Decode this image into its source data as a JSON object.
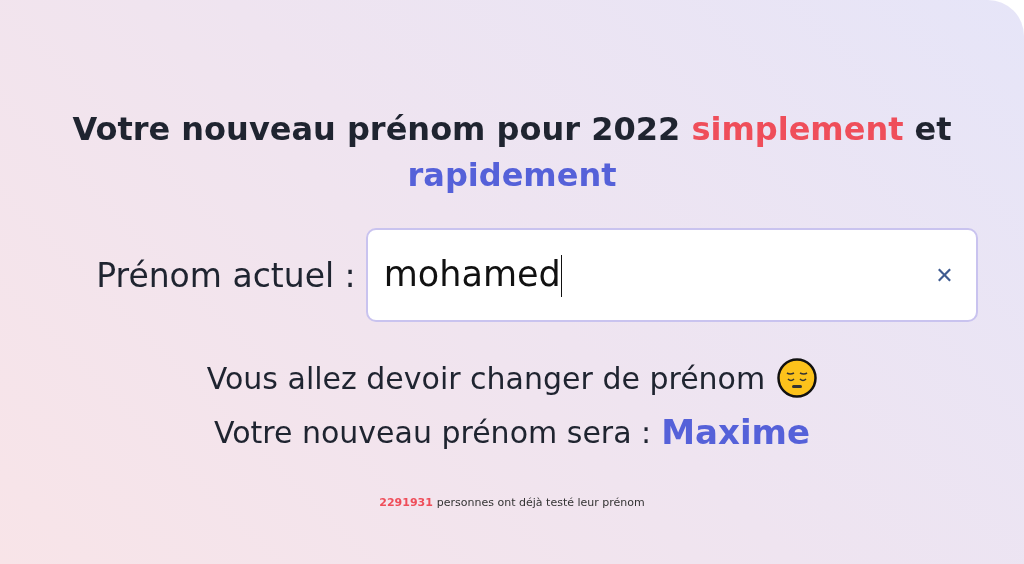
{
  "title": [
    {
      "text": "Votre nouveau prénom pour 2022 ",
      "kind": "plain"
    },
    {
      "text": "simplement",
      "kind": "red"
    },
    {
      "text": " et ",
      "kind": "plain"
    },
    {
      "text": "rapidement",
      "kind": "blue"
    }
  ],
  "field": {
    "label": "Prénom actuel :",
    "value": "mohamed",
    "clear": "✕"
  },
  "verdict": "Vous allez devoir changer de prénom",
  "result": {
    "label": "Votre nouveau prénom sera :",
    "name": "Maxime"
  },
  "footer": {
    "count": "2291931",
    "text": "personnes ont déjà testé leur prénom"
  }
}
